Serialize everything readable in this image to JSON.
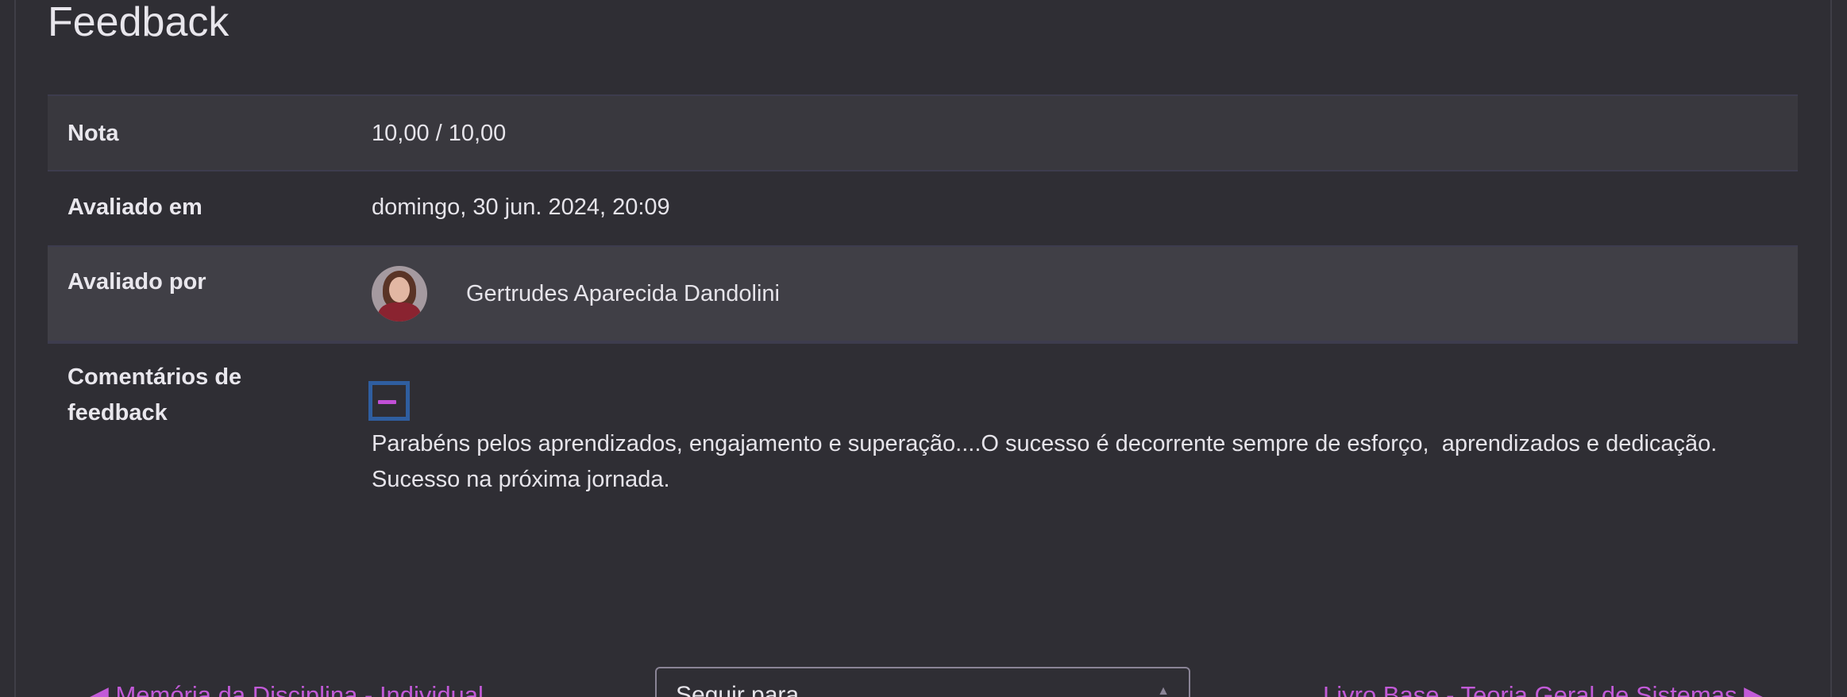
{
  "section_title": "Feedback",
  "rows": {
    "nota": {
      "label": "Nota",
      "value": "10,00 / 10,00"
    },
    "avaliado_em": {
      "label": "Avaliado em",
      "value": "domingo, 30 jun. 2024, 20:09"
    },
    "avaliado_por": {
      "label": "Avaliado por",
      "grader_name": "Gertrudes Aparecida Dandolini"
    },
    "comentarios": {
      "label": "Comentários de feedback",
      "text": "Parabéns pelos aprendizados, engajamento e superação....O sucesso é decorrente sempre de esforço,  aprendizados e dedicação. Sucesso na próxima jornada."
    }
  },
  "navigation": {
    "prev_link": "◀ Memória da Disciplina - Individual",
    "jump_select_value": "Seguir para...",
    "next_link": "Livro Base - Teoria Geral de Sistemas ▶"
  },
  "colors": {
    "background": "#2f2e34",
    "link": "#c25ad8",
    "toggle_border": "#2f5ea0",
    "toggle_dash": "#c24fd6"
  },
  "icons": {
    "collapse": "minus-icon",
    "avatar": "user-avatar",
    "select_caret": "chevron-up-down-icon"
  }
}
